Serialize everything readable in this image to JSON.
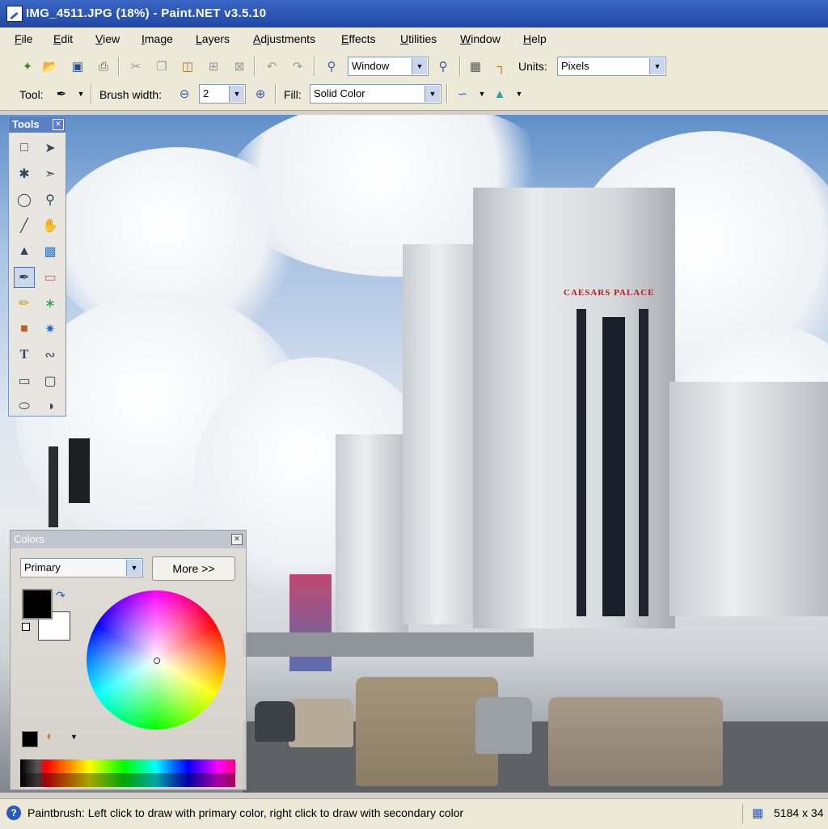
{
  "window": {
    "title": "IMG_4511.JPG (18%) - Paint.NET v3.5.10"
  },
  "menu": [
    "File",
    "Edit",
    "View",
    "Image",
    "Layers",
    "Adjustments",
    "Effects",
    "Utilities",
    "Window",
    "Help"
  ],
  "toolbar": {
    "zoom_value": "Window",
    "units_label": "Units:",
    "units_value": "Pixels",
    "tool_label": "Tool:",
    "brush_width_label": "Brush width:",
    "brush_width_value": "2",
    "fill_label": "Fill:",
    "fill_value": "Solid Color",
    "icons": [
      "new-image-icon",
      "open-icon",
      "save-icon",
      "print-icon",
      "cut-icon",
      "copy-icon",
      "paste-icon",
      "crop-icon",
      "deselect-icon",
      "undo-icon",
      "redo-icon",
      "zoom-out-icon",
      "zoom-in-icon",
      "grid-icon",
      "rulers-icon"
    ]
  },
  "tools_panel": {
    "title": "Tools",
    "tools": [
      "rectangle-select",
      "move-selection",
      "lasso-select",
      "move-selected",
      "ellipse-select",
      "zoom",
      "magic-wand",
      "pan",
      "paint-bucket",
      "gradient",
      "paintbrush",
      "eraser",
      "pencil",
      "color-picker",
      "clone-stamp",
      "recolor",
      "text",
      "line-curve",
      "rectangle",
      "rounded-rectangle",
      "ellipse",
      "freeform-shape"
    ],
    "selected": "paintbrush"
  },
  "colors_panel": {
    "title": "Colors",
    "mode_value": "Primary",
    "more_button": "More >>",
    "primary_color": "#000000",
    "secondary_color": "#ffffff"
  },
  "canvas": {
    "sign_text": "CAESARS PALACE"
  },
  "status": {
    "hint": "Paintbrush: Left click to draw with primary color, right click to draw with secondary color",
    "image_size": "5184 x 34"
  },
  "colors": {
    "titlebar": "#2a56b8",
    "chrome": "#ece9d8",
    "accent": "#4c6fb5"
  }
}
